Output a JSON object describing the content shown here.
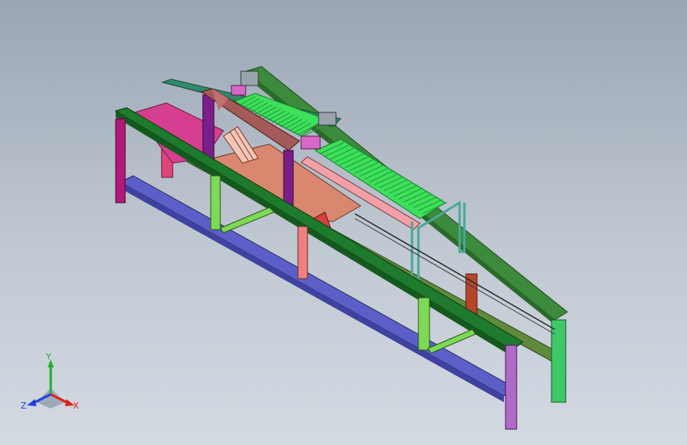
{
  "viewport": {
    "background_top": "#9aa6b4",
    "background_bottom": "#d4dae2"
  },
  "model": {
    "part_colors": {
      "frame_dark_green": "#1e7a2c",
      "frame_blue": "#5c5fc8",
      "leg_magenta": "#b0197a",
      "leg_lime": "#7ed957",
      "leg_salmon": "#f08080",
      "roller_green": "#3de05a",
      "bed_salmon": "#d9876e",
      "bed_pink": "#d63f8f",
      "gantry_brown": "#8a3a3a",
      "rail_pink": "#f2a0a8",
      "rail_teal": "#4aa79a"
    }
  },
  "triad": {
    "x_label": "X",
    "y_label": "Y",
    "z_label": "Z",
    "x_color": "#e02020",
    "y_color": "#20b030",
    "z_color": "#2040e0"
  }
}
